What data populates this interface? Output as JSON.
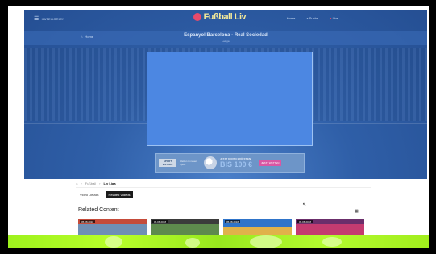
{
  "header": {
    "menu_label": "KATEGORIEN",
    "logo_text": "Fußball Liv",
    "nav": [
      "Home",
      "Suche",
      "Live"
    ]
  },
  "match": {
    "crumb": "Home",
    "title": "Espanyol Barcelona - Real Sociedad",
    "subtitle": "LaLiga"
  },
  "ad": {
    "badge": "SPORT WETTEN",
    "middle": "Wetten in neuer Sport",
    "headline": "JETZT KONTO ERÖFFNEN",
    "bonus": "BIS 100 €",
    "cta": "JETZT WETTEN"
  },
  "breadcrumb": {
    "items": [
      "Fußball",
      "LIv Liga"
    ]
  },
  "tabs": [
    {
      "label": "Video Details",
      "active": false
    },
    {
      "label": "Related Videos",
      "active": true
    }
  ],
  "related": {
    "title": "Related Content",
    "thumbs": [
      {
        "date": "05.08.2018"
      },
      {
        "date": "05.08.2018"
      },
      {
        "date": "05.08.2018"
      },
      {
        "date": "05.08.2018"
      }
    ]
  },
  "colors": {
    "hero_blue": "#2f5fa8",
    "player_blue": "#4c87e2",
    "overlay_green": "#a6f01f"
  }
}
